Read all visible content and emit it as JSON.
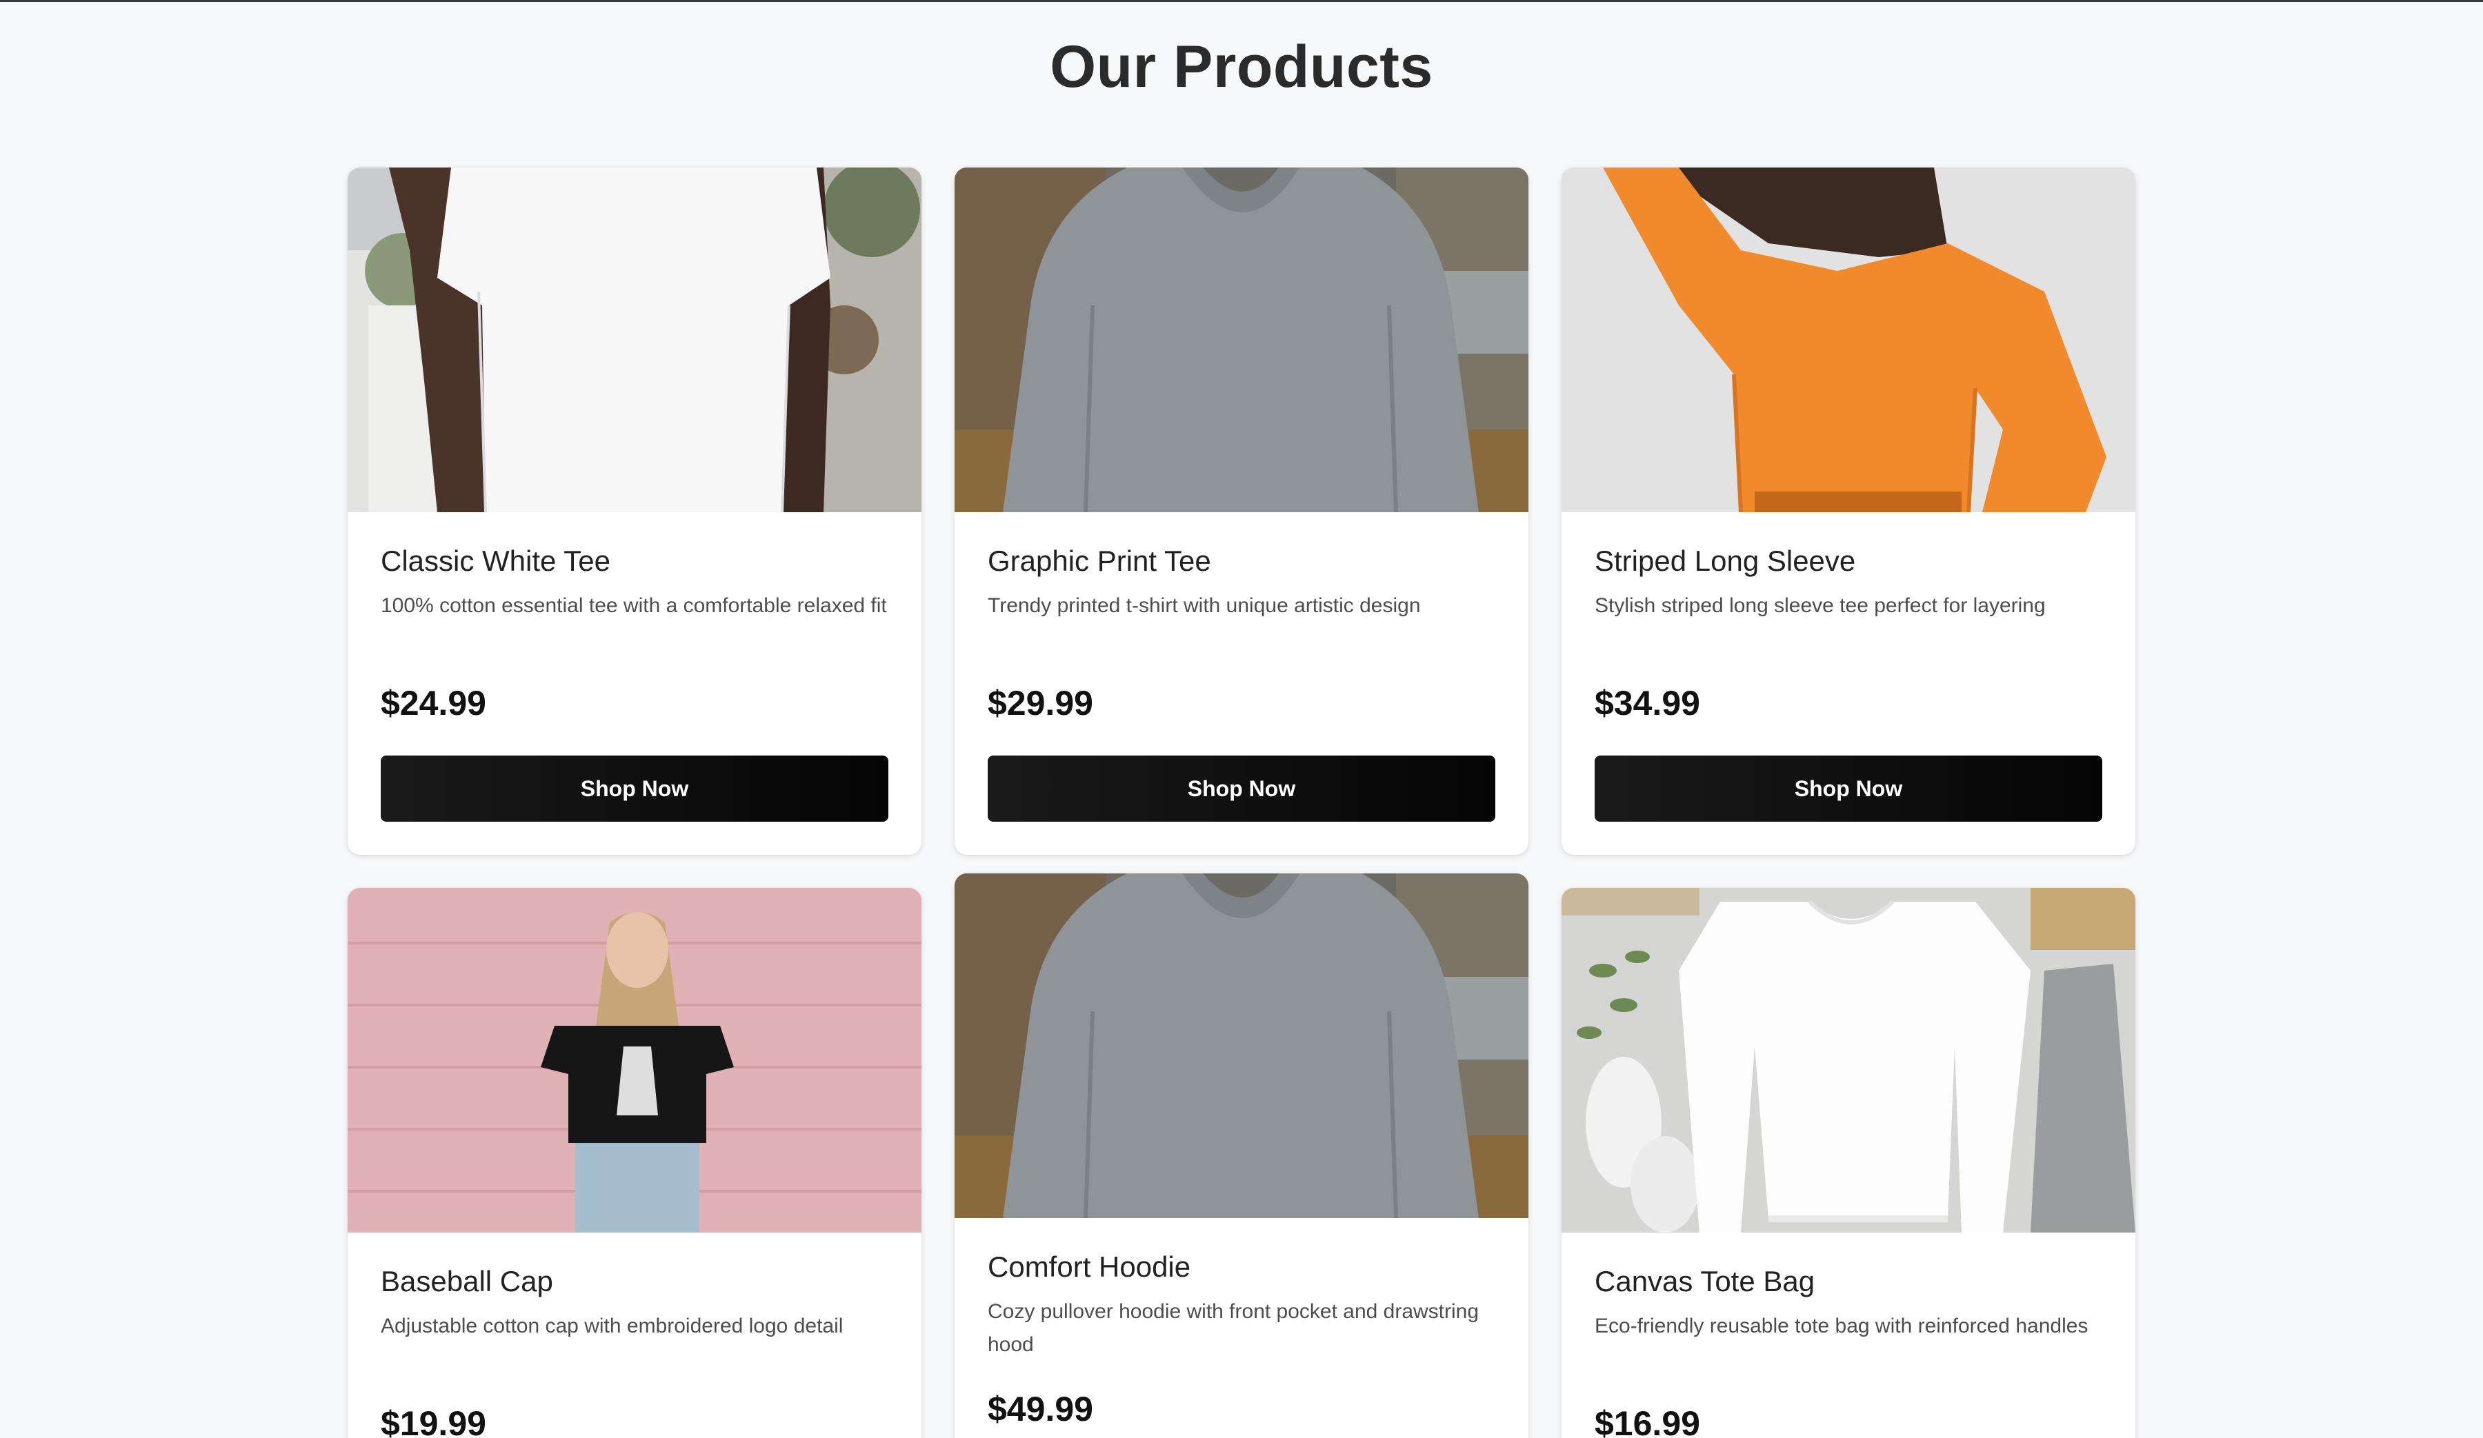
{
  "page": {
    "title": "Our Products"
  },
  "products": [
    {
      "name": "Classic White Tee",
      "description": "100% cotton essential tee with a comfortable relaxed fit",
      "price": "$24.99",
      "button": "Shop Now",
      "image_icon": "white-tshirt-photo"
    },
    {
      "name": "Graphic Print Tee",
      "description": "Trendy printed t-shirt with unique artistic design",
      "price": "$29.99",
      "button": "Shop Now",
      "image_icon": "grey-hoodie-back-photo"
    },
    {
      "name": "Striped Long Sleeve",
      "description": "Stylish striped long sleeve tee perfect for layering",
      "price": "$34.99",
      "button": "Shop Now",
      "image_icon": "orange-sweatshirt-photo"
    },
    {
      "name": "Baseball Cap",
      "description": "Adjustable cotton cap with embroidered logo detail",
      "price": "$19.99",
      "image_icon": "black-graphic-tee-pink-wall-photo"
    },
    {
      "name": "Comfort Hoodie",
      "description": "Cozy pullover hoodie with front pocket and drawstring hood",
      "price": "$49.99",
      "image_icon": "grey-hoodie-back-photo"
    },
    {
      "name": "Canvas Tote Bag",
      "description": "Eco-friendly reusable tote bag with reinforced handles",
      "price": "$16.99",
      "image_icon": "white-sweatshirt-flatlay-photo"
    }
  ],
  "colors": {
    "background": "#f6f8fa",
    "button": "#111111",
    "card": "#ffffff"
  }
}
